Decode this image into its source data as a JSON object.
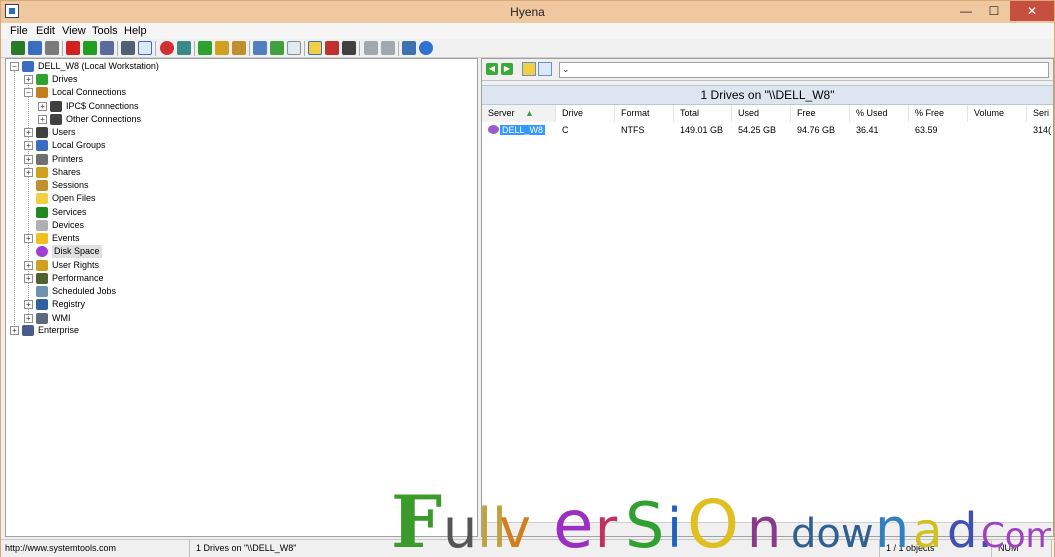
{
  "window": {
    "title": "Hyena",
    "min": "—",
    "max": "☐",
    "close": "✕"
  },
  "menu": [
    "File",
    "Edit",
    "View",
    "Tools",
    "Help"
  ],
  "colors": {
    "titlebar": "#f0c8a0",
    "selection": "#3399ff",
    "close": "#c74f3f"
  },
  "tree": {
    "root": "DELL_W8 (Local Workstation)",
    "items": [
      {
        "label": "Drives",
        "icon": "drives-icon"
      },
      {
        "label": "Local Connections",
        "icon": "connections-icon"
      },
      {
        "label": "IPC$ Connections",
        "icon": "ipc-connections-icon"
      },
      {
        "label": "Other Connections",
        "icon": "other-connections-icon"
      },
      {
        "label": "Users",
        "icon": "users-icon"
      },
      {
        "label": "Local Groups",
        "icon": "groups-icon"
      },
      {
        "label": "Printers",
        "icon": "printer-icon"
      },
      {
        "label": "Shares",
        "icon": "shares-icon"
      },
      {
        "label": "Sessions",
        "icon": "sessions-icon"
      },
      {
        "label": "Open Files",
        "icon": "folder-icon"
      },
      {
        "label": "Services",
        "icon": "services-icon"
      },
      {
        "label": "Devices",
        "icon": "devices-icon"
      },
      {
        "label": "Events",
        "icon": "warning-icon"
      },
      {
        "label": "Disk Space",
        "icon": "disk-space-icon"
      },
      {
        "label": "User Rights",
        "icon": "user-rights-icon"
      },
      {
        "label": "Performance",
        "icon": "performance-icon"
      },
      {
        "label": "Scheduled Jobs",
        "icon": "scheduled-jobs-icon"
      },
      {
        "label": "Registry",
        "icon": "registry-icon"
      },
      {
        "label": "WMI",
        "icon": "wmi-icon"
      }
    ],
    "enterprise": "Enterprise"
  },
  "right": {
    "header": "1 Drives on \"\\\\DELL_W8\"",
    "columns": [
      "Server",
      "Drive",
      "Format",
      "Total",
      "Used",
      "Free",
      "% Used",
      "% Free",
      "Volume",
      "Seri"
    ],
    "rows": [
      [
        "DELL_W8",
        "C",
        "NTFS",
        "149.01 GB",
        "54.25 GB",
        "94.76 GB",
        "36.41",
        "63.59",
        "",
        "314("
      ]
    ]
  },
  "status": {
    "url": "http://www.systemtools.com",
    "drives": "1 Drives on \"\\\\DELL_W8\"",
    "objects": "1 / 1 objects",
    "num": "NUM"
  },
  "watermark": "FullVersionDownload.Com"
}
